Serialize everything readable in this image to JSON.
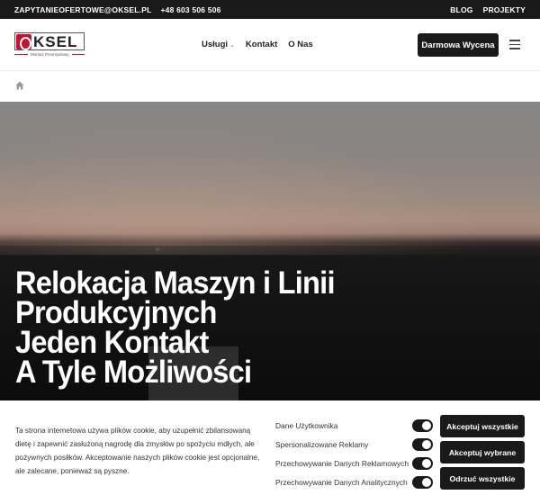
{
  "topbar": {
    "email": "ZAPYTANIEOFERTOWE@OKSEL.PL",
    "phone": "+48 603 506 506",
    "links": [
      "BLOG",
      "PROJEKTY"
    ]
  },
  "logo": {
    "letter_o": "O",
    "text": "KSEL",
    "tagline": "Montaż Przemysłowy",
    "brand_color": "#c8102e"
  },
  "nav": {
    "items": [
      {
        "label": "Usługi",
        "has_dropdown": true
      },
      {
        "label": "Kontakt",
        "has_dropdown": false
      },
      {
        "label": "O Nas",
        "has_dropdown": false
      }
    ],
    "cta_label": "Darmowa Wycena",
    "menu_icon": "hamburger-icon"
  },
  "breadcrumb": {
    "icon": "home-icon"
  },
  "hero": {
    "headline_lines": [
      "Relokacja Maszyn i Linii",
      "Produkcyjnych",
      "Jeden Kontakt",
      "A Tyle Możliwości"
    ]
  },
  "cookie": {
    "text": "Ta strona internetowa używa plików cookie, aby uzupełnić zbilansowaną dietę i zapewnić zasłużoną nagrodę dla zmysłów po spożyciu mdłych, ale pożywnych posiłków. Akceptowanie naszych plików cookie jest opcjonalne, ale zalecane, ponieważ są pyszne.",
    "toggles": [
      {
        "label": "Dane Użytkownika",
        "on": true
      },
      {
        "label": "Spersonalizowane Reklamy",
        "on": true
      },
      {
        "label": "Przechowywanie Danych Reklamowych",
        "on": true
      },
      {
        "label": "Przechowywanie Danych Analitycznych",
        "on": true
      }
    ],
    "buttons": {
      "accept_all": "Akceptuj wszystkie",
      "accept_selected": "Akceptuj wybrane",
      "reject_all": "Odrzuć wszystkie"
    }
  }
}
